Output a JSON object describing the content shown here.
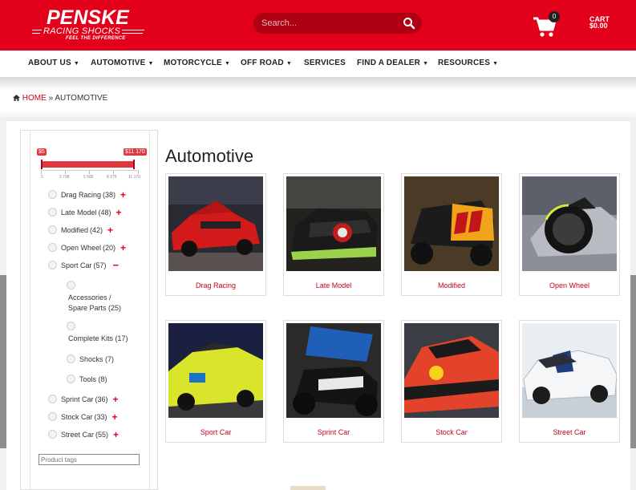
{
  "header": {
    "logo_brand": "PENSKE",
    "logo_sub": "RACING SHOCKS",
    "logo_tag": "FEEL THE DIFFERENCE",
    "search_placeholder": "Search...",
    "cart_count": "0",
    "cart_label": "CART",
    "cart_total": "$0.00",
    "brand_color": "#e2001a"
  },
  "nav": {
    "items": [
      {
        "label": "ABOUT US",
        "dropdown": true
      },
      {
        "label": "AUTOMOTIVE",
        "dropdown": true
      },
      {
        "label": "MOTORCYCLE",
        "dropdown": true
      },
      {
        "label": "OFF ROAD",
        "dropdown": true
      },
      {
        "label": "SERVICES",
        "dropdown": false
      },
      {
        "label": "FIND A DEALER",
        "dropdown": true
      },
      {
        "label": "RESOURCES",
        "dropdown": true
      }
    ],
    "caret": "▼"
  },
  "breadcrumb": {
    "home": "HOME",
    "separator": "»",
    "current": "AUTOMOTIVE"
  },
  "price_filter": {
    "min_label": "$5",
    "max_label": "$11 170",
    "ticks": [
      "5",
      "2 798",
      "5 585",
      "8 375",
      "11 170"
    ]
  },
  "categories": [
    {
      "label": "Drag Racing",
      "count": "(38)",
      "toggle": "+"
    },
    {
      "label": "Late Model",
      "count": "(48)",
      "toggle": "+"
    },
    {
      "label": "Modified",
      "count": "(42)",
      "toggle": "+"
    },
    {
      "label": "Open Wheel",
      "count": "(20)",
      "toggle": "+"
    },
    {
      "label": "Sport Car",
      "count": "(57)",
      "toggle": "−"
    },
    {
      "label": "Sprint Car",
      "count": "(36)",
      "toggle": "+"
    },
    {
      "label": "Stock Car",
      "count": "(33)",
      "toggle": "+"
    },
    {
      "label": "Street Car",
      "count": "(55)",
      "toggle": "+"
    }
  ],
  "sport_car_children": [
    {
      "line1": "Accessories /",
      "line2": "Spare Parts (25)"
    },
    {
      "line1": "Complete Kits (17)",
      "line2": ""
    },
    {
      "line1": "Shocks (7)",
      "line2": ""
    },
    {
      "line1": "Tools (8)",
      "line2": ""
    }
  ],
  "tags_placeholder": "Product tags",
  "page": {
    "title": "Automotive"
  },
  "products": [
    {
      "label": "Drag Racing"
    },
    {
      "label": "Late Model"
    },
    {
      "label": "Modified"
    },
    {
      "label": "Open Wheel"
    },
    {
      "label": "Sport Car"
    },
    {
      "label": "Sprint Car"
    },
    {
      "label": "Stock Car"
    },
    {
      "label": "Street Car"
    }
  ]
}
